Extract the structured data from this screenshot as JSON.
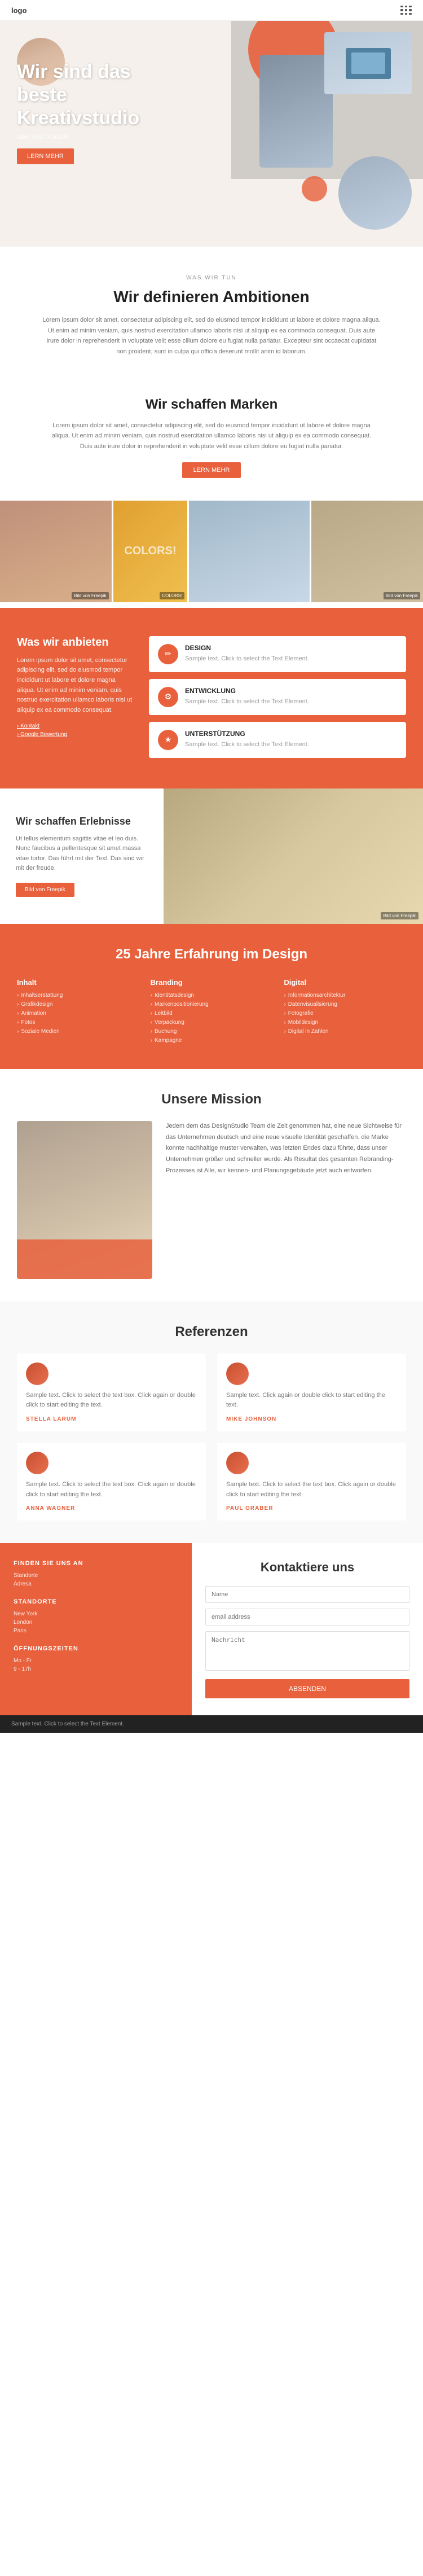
{
  "nav": {
    "logo": "logo",
    "menu_items": [
      "",
      "",
      "",
      "",
      ""
    ],
    "grid_icon_label": "menu-grid"
  },
  "hero": {
    "title": "Wir sind das beste Kreativstudio",
    "subtitle": "Über uns / Kontakt",
    "btn_label": "LERN MEHR"
  },
  "was_wir_tun": {
    "tag": "WAS WIR TUN",
    "title": "Wir definieren Ambitionen",
    "text": "Lorem ipsum dolor sit amet, consectetur adipiscing elit, sed do eiusmod tempor incididunt ut labore et dolore magna aliqua. Ut enim ad minim veniam, quis nostrud exercitation ullamco laboris nisi ut aliquip ex ea commodo consequat. Duis aute irure dolor in reprehenderit in voluptate velit esse cillum dolore eu fugiat nulla pariatur. Excepteur sint occaecat cupidatat non proident, sunt in culpa qui officia deserunt mollit anim id laborum."
  },
  "wir_schaffen_marken": {
    "title": "Wir schaffen Marken",
    "text": "Lorem ipsum dolor sit amet, consectetur adipiscing elit, sed do eiusmod tempor incididunt ut labore et dolore magna aliqua. Ut enim ad minim veniam, quis nostrud exercitation ullamco laboris nisi ut aliquip ex ea commodo consequat. Duis aute irure dolor in reprehenderit in voluptate velit esse cillum dolore eu fugiat nulla pariatur.",
    "btn_label": "LERN MEHR",
    "images": [
      {
        "label": "Bild von Freepik",
        "type": "person"
      },
      {
        "label": "Colors!",
        "type": "colors"
      },
      {
        "label": "",
        "type": "workspace"
      },
      {
        "label": "Bild von Freepik",
        "type": "person2"
      },
      {
        "label": "",
        "type": "crafts"
      }
    ]
  },
  "was_wir_anbieten": {
    "left_title": "Was wir anbieten",
    "left_text": "Lorem ipsum dolor sit amet, consectetur adipiscing elit, sed do eiusmod tempor incididunt ut labore et dolore magna aliqua. Ut enim ad minim veniam, quis nostrud exercitation ullamco laboris nisi ut aliquip ex ea commodo consequat.",
    "left_links": [
      "Kontakt",
      "Google Bewertung"
    ],
    "services": [
      {
        "title": "DESIGN",
        "text": "Sample text. Click to select the Text Element.",
        "icon": "✏"
      },
      {
        "title": "ENTWICKLUNG",
        "text": "Sample text. Click to select the Text Element.",
        "icon": "⚙"
      },
      {
        "title": "UNTERSTÜTZUNG",
        "text": "Sample text. Click to select the Text Element.",
        "icon": "★"
      }
    ]
  },
  "wir_schaffen_erlebnisse": {
    "title": "Wir schaffen Erlebnisse",
    "text": "Ut tellus elementum sagittis vitae et leo duis. Nunc faucibus a pellentesque sit amet massa vitae tortor. Das führt mit der Text. Das sind wir mit der freude.",
    "btn_label": "Bild von Freepik",
    "image_label": "Bild von Freepik"
  },
  "jahre_section": {
    "title": "25 Jahre Erfahrung im Design",
    "columns": [
      {
        "title": "Inhalt",
        "items": [
          "Inhaltserstattung",
          "Grafikdesign",
          "Animation",
          "Fotos",
          "Soziale Medien"
        ]
      },
      {
        "title": "Branding",
        "items": [
          "Identitätsdesign",
          "Markenpositionierung",
          "Leitbild",
          "Verpackung",
          "Buchung",
          "Kampagne"
        ]
      },
      {
        "title": "Digital",
        "items": [
          "Informationsarchitektur",
          "Datenvisualisierung",
          "Fotografie",
          "Mobildesign",
          "Digital in Zahlen"
        ]
      }
    ]
  },
  "mission": {
    "title": "Unsere Mission",
    "text": "Jedem dem das DesignStudio Team die Zeit genommen hat, eine neue Sichtweise für das Unternehmen deutsch und eine neue visuelle Identität geschaffen. die Marke konnte nachhaltige muster verwalten, was letzten Endes dazu führte, dass unser Unternehmen größer und schneller wurde. Als Resultat des gesamten Rebranding-Prozesses ist Alle, wir kennen- und Planungsgebäude jetzt auch entworfen."
  },
  "referenzen": {
    "title": "Referenzen",
    "items": [
      {
        "text": "Sample text. Click to select the text box. Click again or double click to start editing the text.",
        "name": "STELLA LARUM",
        "avatar_color": "#e8603c"
      },
      {
        "text": "Sample text. Click again or double click to start editing the text.",
        "name": "MIKE JOHNSON",
        "avatar_color": "#e8603c"
      },
      {
        "text": "Sample text. Click to select the text box. Click again or double click to start editing the text.",
        "name": "ANNA WAGNER",
        "avatar_color": "#e8603c"
      },
      {
        "text": "Sample text. Click to select the text box. Click again or double click to start editing the text.",
        "name": "PAUL GRABER",
        "avatar_color": "#e8603c"
      }
    ]
  },
  "footer_info": {
    "columns": [
      {
        "title": "FINDEN SIE UNS AN",
        "items": [
          "Standorte",
          "Adresa"
        ]
      },
      {
        "title": "STANDORTE",
        "items": [
          "New York",
          "London",
          "Paris"
        ]
      },
      {
        "title": "ÖFFNUNGSZEITEN",
        "items": [
          "Mo - Fr",
          "9 - 17h"
        ]
      }
    ]
  },
  "contact": {
    "title": "Kontaktiere uns",
    "name_placeholder": "Name",
    "email_placeholder": "email address",
    "message_placeholder": "Nachricht",
    "btn_label": "ABSENDEN"
  },
  "bottom_bar": {
    "left": "Sample text. Click to select the Text Element.",
    "right": ""
  }
}
